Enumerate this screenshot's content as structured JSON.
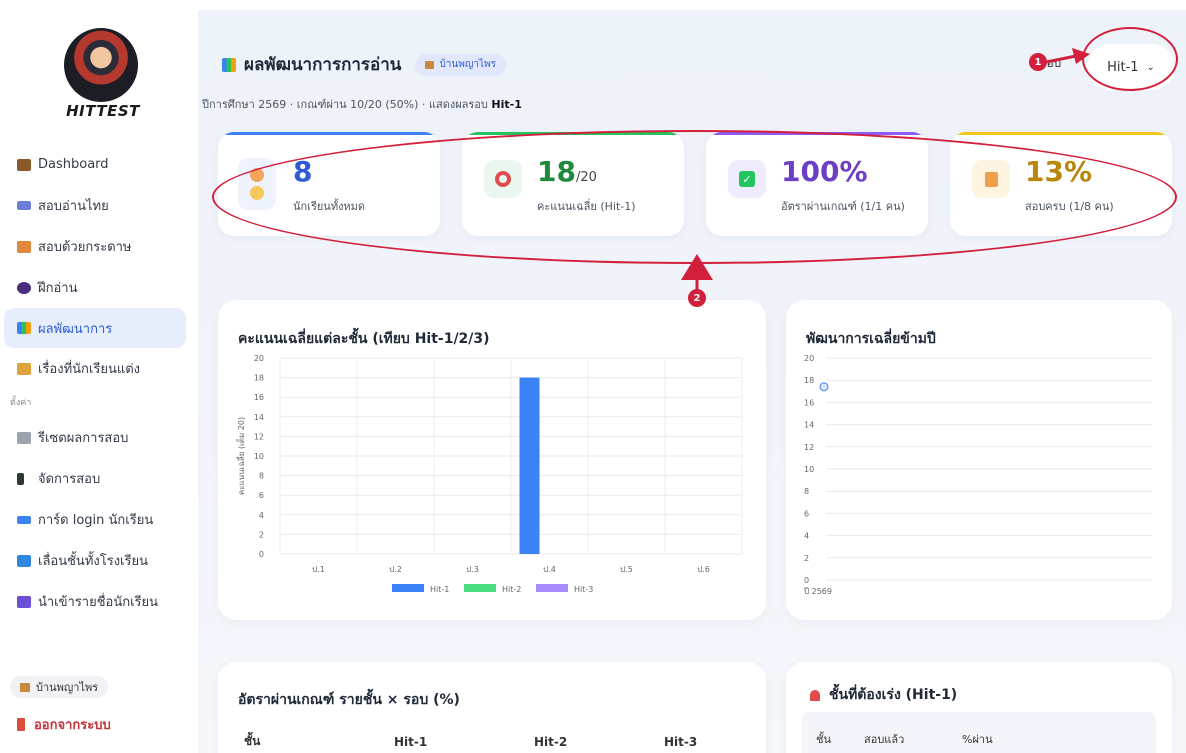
{
  "brand": {
    "logo_text": "HITTEST"
  },
  "sidebar": {
    "items": [
      {
        "label": "Dashboard",
        "icon": "home-icon",
        "color": "#8b5a2b"
      },
      {
        "label": "สอบอ่านไทย",
        "icon": "book-icon",
        "color": "#6b7fd7"
      },
      {
        "label": "สอบด้วยกระดาษ",
        "icon": "paper-icon",
        "color": "#e0893b"
      },
      {
        "label": "ฝึกอ่าน",
        "icon": "speaking-head-icon",
        "color": "#4b2c7a"
      },
      {
        "label": "ผลพัฒนาการ",
        "icon": "chart-icon",
        "color": "#3b82f6",
        "active": true
      },
      {
        "label": "เรื่องที่นักเรียนแต่ง",
        "icon": "writing-hand-icon",
        "color": "#e0a33b"
      }
    ],
    "section_label": "ตั้งค่า",
    "settings": [
      {
        "label": "รีเซตผลการสอบ",
        "icon": "trash-icon",
        "color": "#9aa3ae"
      },
      {
        "label": "จัดการสอบ",
        "icon": "traffic-light-icon",
        "color": "#2f3a2f"
      },
      {
        "label": "การ์ด login นักเรียน",
        "icon": "id-card-icon",
        "color": "#3b82f6"
      },
      {
        "label": "เลื่อนชั้นทั้งโรงเรียน",
        "icon": "up-arrow-icon",
        "color": "#2e86de"
      },
      {
        "label": "นำเข้ารายชื่อนักเรียน",
        "icon": "inbox-icon",
        "color": "#6b4fd7"
      }
    ],
    "school_chip": "บ้านพญาไพร",
    "logout": "ออกจากระบบ"
  },
  "header": {
    "title": "ผลพัฒนาการการอ่าน",
    "school": "บ้านพญาไพร",
    "subtitle_prefix": "ปีการศึกษา 2569 · เกณฑ์ผ่าน 10/20 (50%) · แสดงผลรอบ ",
    "subtitle_round": "Hit-1",
    "round_label": "รอบ",
    "round_value": "Hit-1"
  },
  "stats": [
    {
      "value": "8",
      "suffix": "",
      "label": "นักเรียนทั้งหมด",
      "color": "#2d5bd7",
      "bar": "#3b82f6",
      "badge_bg": "#eef3fe",
      "icon": "students-icon"
    },
    {
      "value": "18",
      "suffix": "/20",
      "label": "คะแนนเฉลี่ย (Hit-1)",
      "color": "#1f8a3b",
      "bar": "#22c55e",
      "badge_bg": "#e9f7ee",
      "icon": "target-icon"
    },
    {
      "value": "100%",
      "suffix": "",
      "label": "อัตราผ่านเกณฑ์ (1/1 คน)",
      "color": "#6d3fc4",
      "bar": "#8b5cf6",
      "badge_bg": "#f1ecfd",
      "icon": "check-icon"
    },
    {
      "value": "13%",
      "suffix": "",
      "label": "สอบครบ (1/8 คน)",
      "color": "#b8860b",
      "bar": "#f5c518",
      "badge_bg": "#fdf5e2",
      "icon": "memo-icon"
    }
  ],
  "chart1": {
    "title": "คะแนนเฉลี่ยแต่ละชั้น (เทียบ Hit-1/2/3)"
  },
  "chart2": {
    "title": "พัฒนาการเฉลี่ยข้ามปี"
  },
  "chart_data": [
    {
      "type": "bar",
      "title": "คะแนนเฉลี่ยแต่ละชั้น (เทียบ Hit-1/2/3)",
      "ylabel": "คะแนนเฉลี่ย (เต็ม 20)",
      "categories": [
        "ป.1",
        "ป.2",
        "ป.3",
        "ป.4",
        "ป.5",
        "ป.6"
      ],
      "series": [
        {
          "name": "Hit-1",
          "color": "#3b82f6",
          "values": [
            0,
            0,
            0,
            18,
            0,
            0
          ]
        },
        {
          "name": "Hit-2",
          "color": "#4ade80",
          "values": [
            0,
            0,
            0,
            0,
            0,
            0
          ]
        },
        {
          "name": "Hit-3",
          "color": "#a78bfa",
          "values": [
            0,
            0,
            0,
            0,
            0,
            0
          ]
        }
      ],
      "ylim": [
        0,
        20
      ],
      "yticks": [
        "0",
        "2",
        "4",
        "6",
        "8",
        "10",
        "12",
        "14",
        "16",
        "18",
        "20"
      ],
      "grid": true,
      "legend": "bottom"
    },
    {
      "type": "line",
      "title": "พัฒนาการเฉลี่ยข้ามปี",
      "x": [
        "ปี 2569"
      ],
      "series": [
        {
          "values": [
            17.4
          ],
          "color": "#3b82f6"
        }
      ],
      "ylim": [
        0,
        20
      ],
      "yticks": [
        "0",
        "2",
        "4",
        "6",
        "8",
        "10",
        "12",
        "14",
        "16",
        "18",
        "20"
      ],
      "grid": true
    }
  ],
  "pass_table": {
    "title": "อัตราผ่านเกณฑ์ รายชั้น × รอบ (%)",
    "headers": [
      "ชั้น",
      "Hit-1",
      "Hit-2",
      "Hit-3"
    ]
  },
  "urgent_table": {
    "title": "ชั้นที่ต้องเร่ง (Hit-1)",
    "headers": [
      "ชั้น",
      "สอบแล้ว",
      "%ผ่าน"
    ]
  },
  "annotations": [
    "1",
    "2"
  ]
}
